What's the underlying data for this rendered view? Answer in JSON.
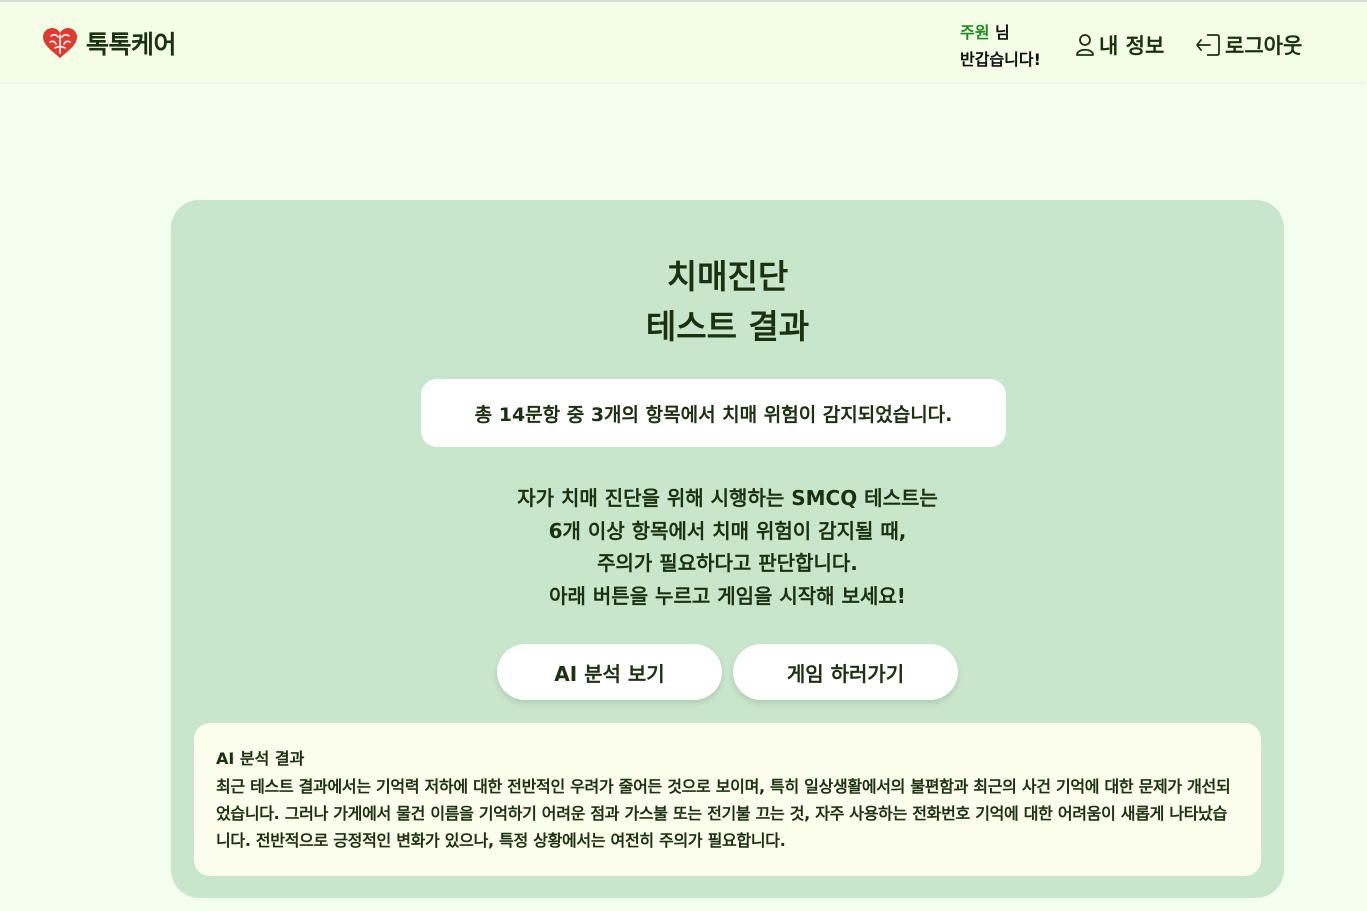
{
  "header": {
    "logo_text": "톡톡케어",
    "greeting_user": "주원",
    "greeting_suffix": " 님",
    "greeting_line2": "반갑습니다!",
    "my_info_label": "내 정보",
    "logout_label": "로그아웃"
  },
  "result": {
    "title_line1": "치매진단",
    "title_line2": "테스트 결과",
    "summary": "총 14문항 중 3개의 항목에서 치매 위험이 감지되었습니다.",
    "desc_lines": [
      "자가 치매 진단을 위해 시행하는 SMCQ 테스트는",
      "6개 이상 항목에서 치매 위험이 감지될 때,",
      "주의가 필요하다고 판단합니다.",
      "아래 버튼을 누르고 게임을 시작해 보세요!"
    ],
    "ai_button": "AI 분석 보기",
    "game_button": "게임 하러가기"
  },
  "analysis": {
    "title": "AI 분석 결과",
    "body": "최근 테스트 결과에서는 기억력 저하에 대한 전반적인 우려가 줄어든 것으로 보이며, 특히 일상생활에서의 불편함과 최근의 사건 기억에 대한 문제가 개선되었습니다. 그러나 가게에서 물건 이름을 기억하기 어려운 점과 가스불 또는 전기불 끄는 것, 자주 사용하는 전화번호 기억에 대한 어려움이 새롭게 나타났습니다. 전반적으로 긍정적인 변화가 있으나, 특정 상황에서는 여전히 주의가 필요합니다."
  },
  "colors": {
    "page_bg": "#f4fff0",
    "header_bg": "#f4fee6",
    "card_bg": "#c8e6cc",
    "analysis_bg": "#fbfeed",
    "text_dark": "#1c3110",
    "username": "#1f8a1f",
    "logo_heart": "#e03a2f"
  },
  "icons": {
    "logo": "brain-heart-icon",
    "my_info": "user-icon",
    "logout": "logout-icon"
  }
}
